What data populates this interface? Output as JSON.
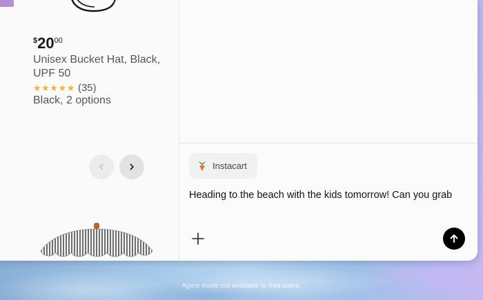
{
  "product": {
    "price_currency": "$",
    "price_dollars": "20",
    "price_cents": "00",
    "title": "Unisex Bucket Hat, Black, UPF 50",
    "stars": "★★★★★",
    "rating_count": "(35)",
    "options": "Black, 2 options",
    "rating_value": 5
  },
  "carousel": {
    "prev_icon": "chevron-left-icon",
    "next_icon": "chevron-right-icon"
  },
  "chat": {
    "app_chip_label": "Instacart",
    "app_chip_icon": "instacart-carrot-icon",
    "message_text": "Heading to the beach with the kids tomorrow! Can you grab",
    "add_icon": "plus-icon",
    "send_icon": "arrow-up-icon"
  },
  "footer": {
    "note": "Agent mode not available to free users."
  },
  "colors": {
    "star": "#f2b531",
    "send_button": "#000000",
    "carrot_orange": "#e8722c",
    "carrot_green": "#2e8b3a"
  }
}
